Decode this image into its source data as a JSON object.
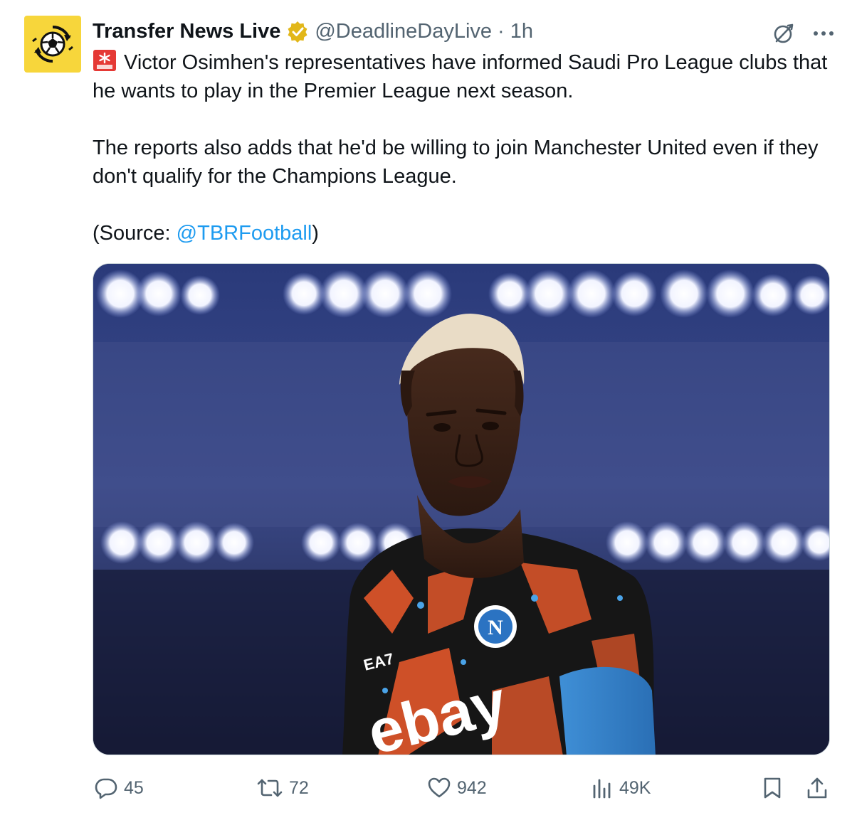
{
  "author": {
    "display_name": "Transfer News Live",
    "handle": "@DeadlineDayLive",
    "separator": "·",
    "time": "1h",
    "verified": true,
    "avatar_icon": "football-with-arrows-icon",
    "avatar_color": "#f7d63b"
  },
  "tweet": {
    "siren_icon": "police-siren-emoji",
    "line1": "Victor Osimhen's representatives have informed Saudi Pro League clubs that he wants to play in the Premier League next season.",
    "line2": "The reports also adds that he'd be willing to join Manchester United even if they don't qualify for the Champions League.",
    "source_prefix": "(Source: ",
    "source_mention": "@TBRFootball",
    "source_suffix": ")"
  },
  "media": {
    "jersey_text": "ebay",
    "sponsor_small": "EA7"
  },
  "actions": {
    "replies": "45",
    "reposts": "72",
    "likes": "942",
    "views": "49K"
  },
  "colors": {
    "text": "#0f1419",
    "muted": "#536471",
    "link": "#1d9bf0",
    "verified_gold": "#e2b719"
  }
}
